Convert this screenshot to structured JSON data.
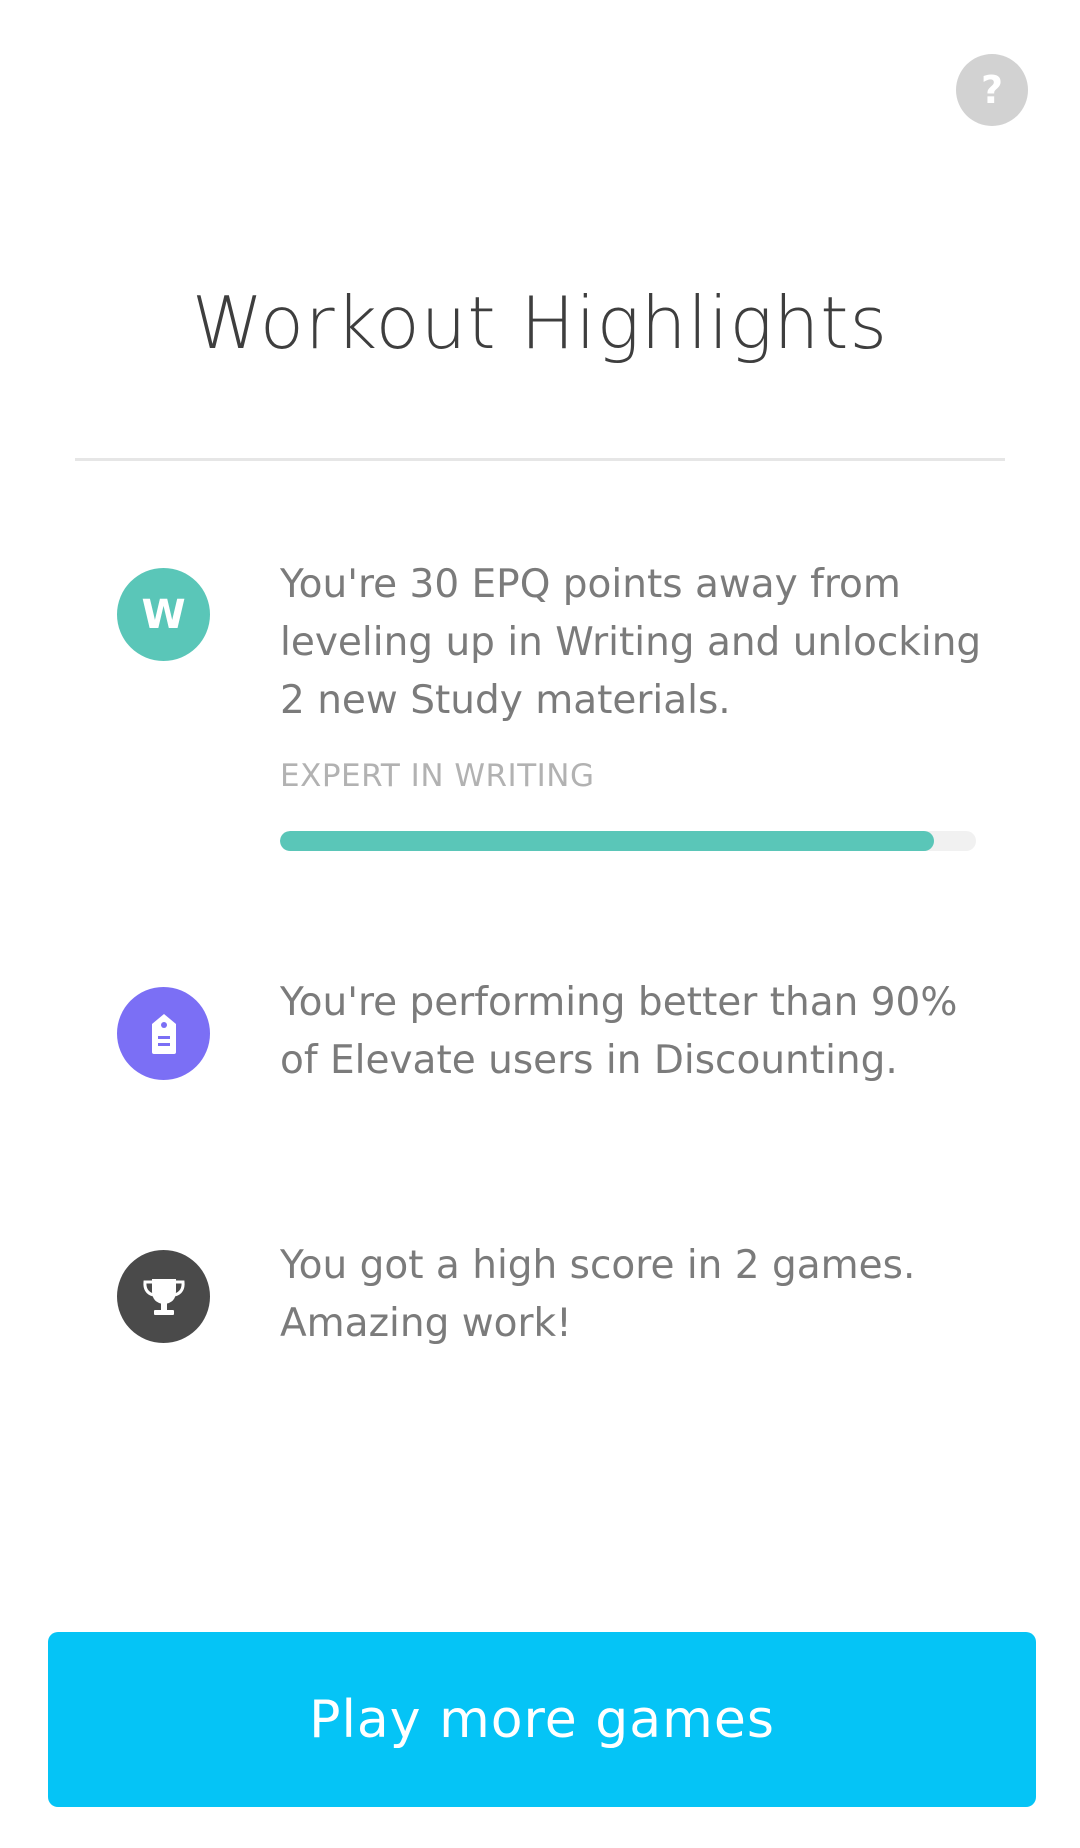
{
  "header": {
    "help_icon": "question-mark-icon",
    "help_glyph": "?",
    "title": "Workout Highlights"
  },
  "highlights": [
    {
      "icon": "letter-w-icon",
      "icon_letter": "W",
      "icon_color": "#5ac6b8",
      "text": "You're 30 EPQ points away from leveling up in Writing and unlocking 2 new Study materials.",
      "skill_label": "EXPERT IN WRITING",
      "progress": 0.94,
      "progress_color": "#5ac6b8"
    },
    {
      "icon": "price-tag-icon",
      "icon_color": "#7b6ff5",
      "text": "You're performing better than 90% of Elevate users in Discounting."
    },
    {
      "icon": "trophy-icon",
      "icon_color": "#4a4a4a",
      "text": "You got a high score in 2 games. Amazing work!"
    }
  ],
  "footer": {
    "play_button_label": "Play more games",
    "play_button_color": "#05c4f6"
  }
}
